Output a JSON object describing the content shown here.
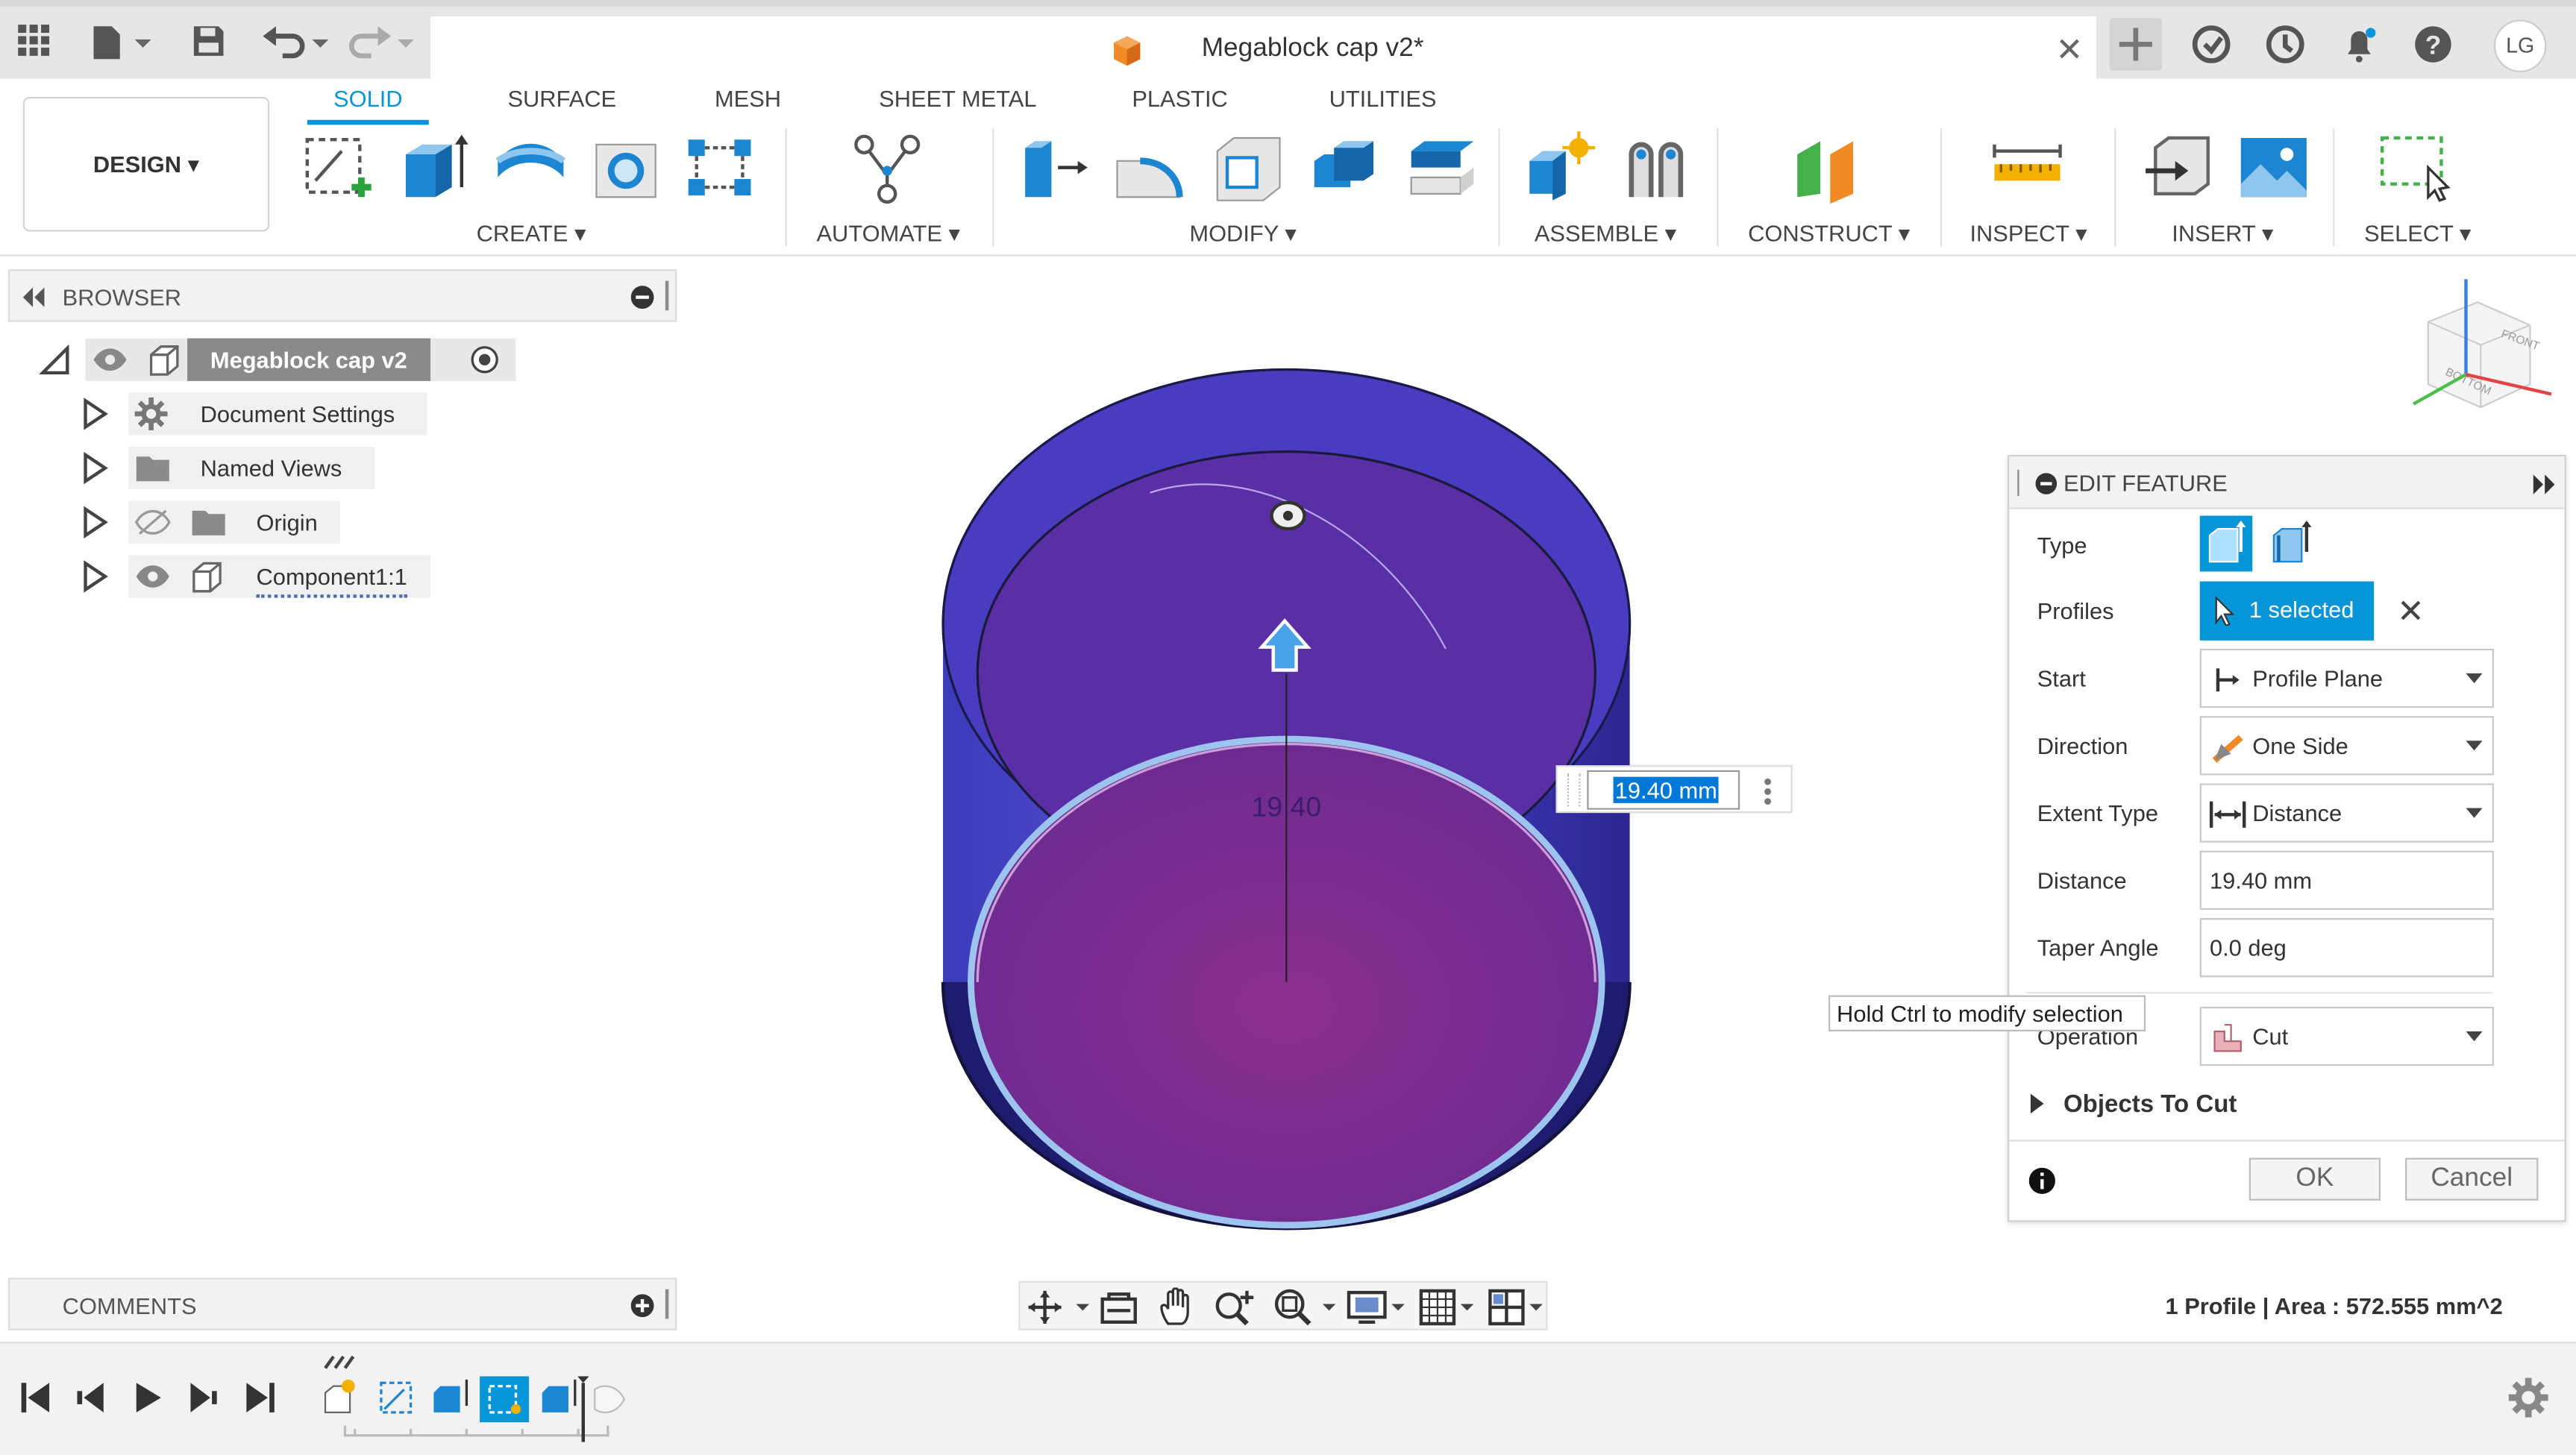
{
  "window": {
    "title": "Megablock cap v2*",
    "user_initials": "LG"
  },
  "toolbar": {
    "workspace": "DESIGN",
    "tabs": [
      "SOLID",
      "SURFACE",
      "MESH",
      "SHEET METAL",
      "PLASTIC",
      "UTILITIES"
    ],
    "active_tab": "SOLID",
    "groups": {
      "create": "CREATE",
      "automate": "AUTOMATE",
      "modify": "MODIFY",
      "assemble": "ASSEMBLE",
      "construct": "CONSTRUCT",
      "inspect": "INSPECT",
      "insert": "INSERT",
      "select": "SELECT"
    }
  },
  "browser": {
    "title": "BROWSER",
    "root": "Megablock cap v2",
    "items": [
      "Document Settings",
      "Named Views",
      "Origin",
      "Component1:1"
    ]
  },
  "viewport": {
    "dimension_input": "19.40 mm",
    "dimension_ghost": "19.40",
    "viewcube": {
      "front": "FRONT",
      "bottom": "BOTTOM"
    }
  },
  "edit_feature": {
    "title": "EDIT FEATURE",
    "rows": {
      "type": "Type",
      "profiles": "Profiles",
      "start": "Start",
      "direction": "Direction",
      "extent_type": "Extent Type",
      "distance": "Distance",
      "taper_angle": "Taper Angle",
      "operation": "Operation"
    },
    "values": {
      "profiles": "1 selected",
      "start": "Profile Plane",
      "direction": "One Side",
      "extent_type": "Distance",
      "distance": "19.40 mm",
      "taper_angle": "0.0 deg",
      "operation": "Cut"
    },
    "objects_to_cut": "Objects To Cut",
    "ok": "OK",
    "cancel": "Cancel"
  },
  "tooltip": "Hold Ctrl to modify selection",
  "comments": {
    "title": "COMMENTS"
  },
  "status": "1 Profile | Area : 572.555 mm^2",
  "colors": {
    "accent": "#0696d7",
    "body_blue": "#2d2aa6",
    "cut_purple": "#7a2b86"
  }
}
